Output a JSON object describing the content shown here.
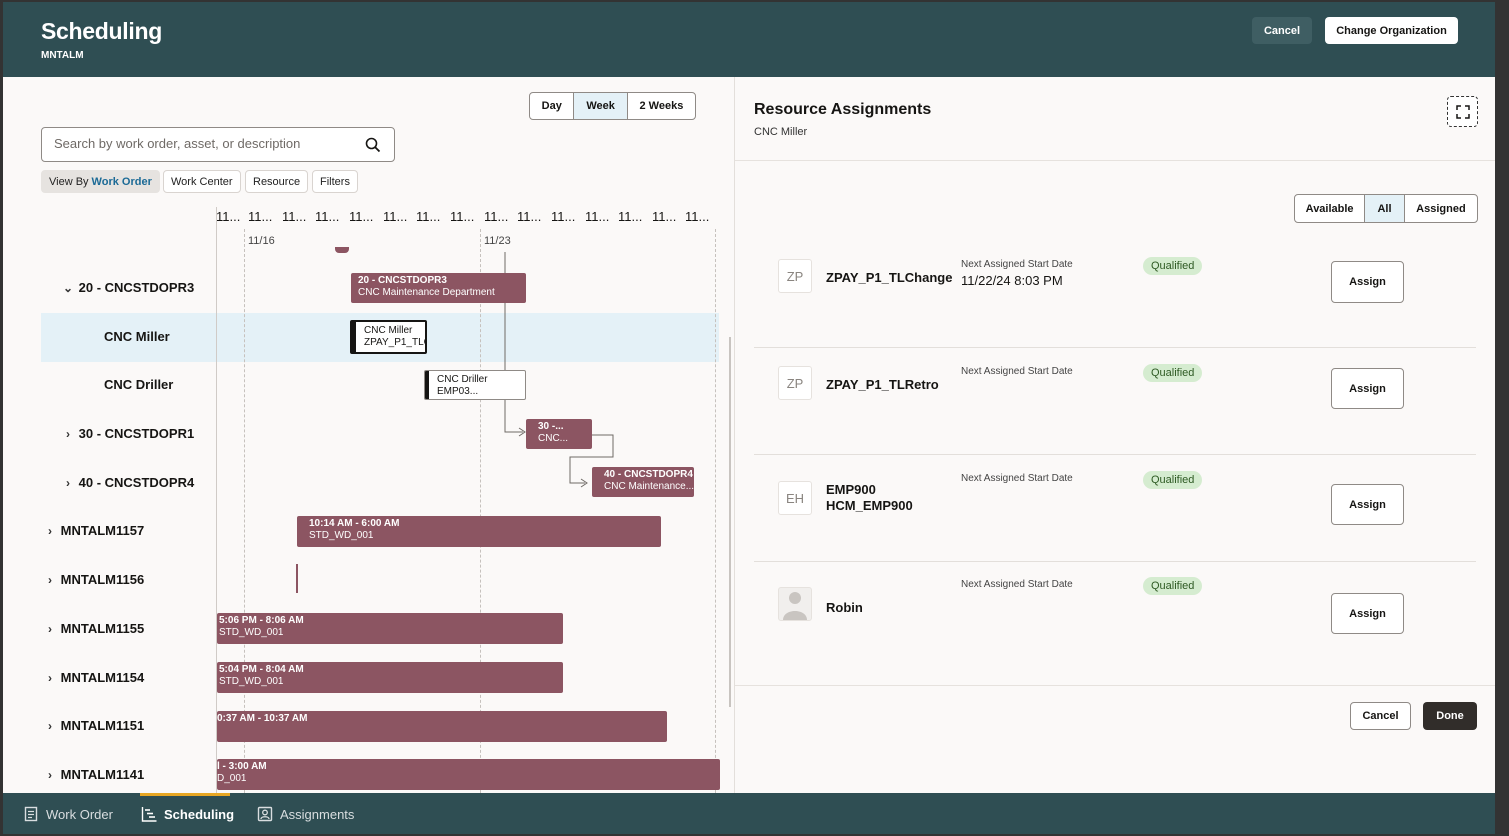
{
  "header": {
    "title": "Scheduling",
    "subtitle": "MNTALM",
    "cancel_label": "Cancel",
    "change_org_label": "Change Organization"
  },
  "gantt": {
    "view_options": [
      "Day",
      "Week",
      "2 Weeks"
    ],
    "selected_view": "Week",
    "search_placeholder": "Search by work order, asset, or description",
    "view_by_label": "View By",
    "view_by_value": "Work Order",
    "chips": [
      "Work Center",
      "Resource",
      "Filters"
    ],
    "tick_labels": [
      "11...",
      "11...",
      "11...",
      "11...",
      "11...",
      "11...",
      "11...",
      "11...",
      "11...",
      "11...",
      "11...",
      "11...",
      "11...",
      "11...",
      "11..."
    ],
    "date_labels": [
      "11/16",
      "11/23"
    ],
    "rows": [
      {
        "label": "20 - CNCSTDOPR3",
        "chevron": "down"
      },
      {
        "label": "CNC Miller",
        "chevron": ""
      },
      {
        "label": "CNC Driller",
        "chevron": ""
      },
      {
        "label": "30 - CNCSTDOPR1",
        "chevron": "right"
      },
      {
        "label": "40 - CNCSTDOPR4",
        "chevron": "right"
      },
      {
        "label": "MNTALM1157",
        "chevron": "right"
      },
      {
        "label": "MNTALM1156",
        "chevron": "right"
      },
      {
        "label": "MNTALM1155",
        "chevron": "right"
      },
      {
        "label": "MNTALM1154",
        "chevron": "right"
      },
      {
        "label": "MNTALM1151",
        "chevron": "right"
      },
      {
        "label": "MNTALM1141",
        "chevron": "right"
      }
    ],
    "bars": [
      {
        "line1": "20 - CNCSTDOPR3",
        "line2": "CNC Maintenance Department"
      },
      {
        "line1": "CNC Miller",
        "line2": "ZPAY_P1_TLC"
      },
      {
        "line1": "CNC Driller",
        "line2": "EMP03..."
      },
      {
        "line1": "30 -...",
        "line2": "CNC..."
      },
      {
        "line1": "40 - CNCSTDOPR4",
        "line2": "CNC Maintenance..."
      },
      {
        "line1": "10:14 AM - 6:00 AM",
        "line2": "STD_WD_001"
      },
      {
        "line1": "5:06 PM - 8:06 AM",
        "line2": "STD_WD_001"
      },
      {
        "line1": "5:04 PM - 8:04 AM",
        "line2": "STD_WD_001"
      },
      {
        "line1": "0:37 AM - 10:37 AM",
        "line2": ""
      },
      {
        "line1": "l - 3:00 AM",
        "line2": "D_001"
      }
    ]
  },
  "panel": {
    "title": "Resource Assignments",
    "subtitle": "CNC Miller",
    "filter_options": [
      "Available",
      "All",
      "Assigned"
    ],
    "selected_filter": "All",
    "next_label": "Next Assigned Start Date",
    "qualified_label": "Qualified",
    "assign_label": "Assign",
    "resources": [
      {
        "initials": "ZP",
        "name": "ZPAY_P1_TLChange",
        "name2": "",
        "next_date": "11/22/24 8:03 PM"
      },
      {
        "initials": "ZP",
        "name": "ZPAY_P1_TLRetro",
        "name2": "",
        "next_date": ""
      },
      {
        "initials": "EH",
        "name": "EMP900",
        "name2": "HCM_EMP900",
        "next_date": ""
      },
      {
        "initials": "",
        "name": "Robin",
        "name2": "",
        "next_date": ""
      }
    ],
    "cancel_label": "Cancel",
    "done_label": "Done"
  },
  "bottom_nav": {
    "items": [
      "Work Order",
      "Scheduling",
      "Assignments"
    ],
    "active": "Scheduling"
  },
  "colors": {
    "header_bg": "#2f4e53",
    "bar": "#8c5562",
    "selected": "#e4f1f7",
    "badge": "#d5ecd0"
  }
}
